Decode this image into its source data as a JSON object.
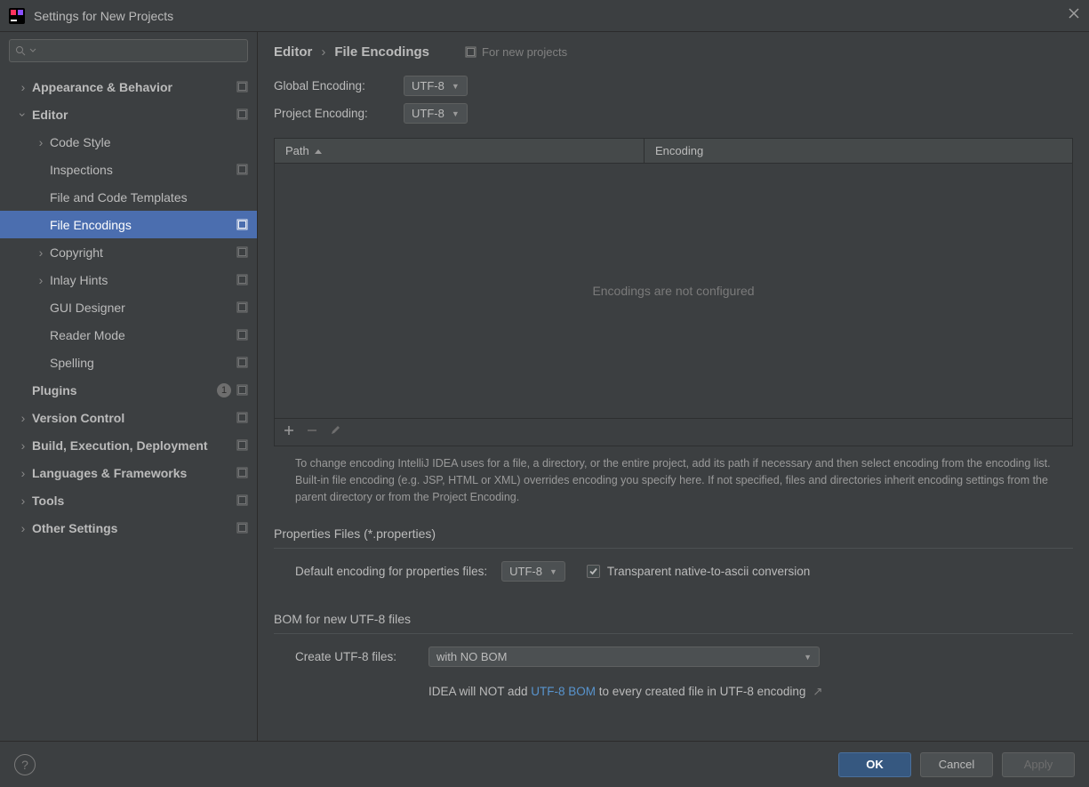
{
  "window": {
    "title": "Settings for New Projects"
  },
  "search": {
    "placeholder": ""
  },
  "tree": {
    "appearance": "Appearance & Behavior",
    "editor": "Editor",
    "code_style": "Code Style",
    "inspections": "Inspections",
    "file_code_templates": "File and Code Templates",
    "file_encodings": "File Encodings",
    "copyright": "Copyright",
    "inlay_hints": "Inlay Hints",
    "gui_designer": "GUI Designer",
    "reader_mode": "Reader Mode",
    "spelling": "Spelling",
    "plugins": "Plugins",
    "plugins_badge": "1",
    "version_control": "Version Control",
    "build": "Build, Execution, Deployment",
    "lang_fw": "Languages & Frameworks",
    "tools": "Tools",
    "other": "Other Settings"
  },
  "breadcrumb": {
    "a": "Editor",
    "b": "File Encodings",
    "hint": "For new projects"
  },
  "encoding": {
    "global_label": "Global Encoding:",
    "global_value": "UTF-8",
    "project_label": "Project Encoding:",
    "project_value": "UTF-8"
  },
  "table": {
    "col_path": "Path",
    "col_encoding": "Encoding",
    "empty": "Encodings are not configured"
  },
  "desc": "To change encoding IntelliJ IDEA uses for a file, a directory, or the entire project, add its path if necessary and then select encoding from the encoding list. Built-in file encoding (e.g. JSP, HTML or XML) overrides encoding you specify here. If not specified, files and directories inherit encoding settings from the parent directory or from the Project Encoding.",
  "props": {
    "title": "Properties Files (*.properties)",
    "label": "Default encoding for properties files:",
    "value": "UTF-8",
    "checkbox_label": "Transparent native-to-ascii conversion"
  },
  "bom": {
    "title": "BOM for new UTF-8 files",
    "label": "Create UTF-8 files:",
    "value": "with NO BOM",
    "info_pre": "IDEA will NOT add ",
    "info_link": "UTF-8 BOM",
    "info_post": " to every created file in UTF-8 encoding"
  },
  "footer": {
    "ok": "OK",
    "cancel": "Cancel",
    "apply": "Apply"
  }
}
